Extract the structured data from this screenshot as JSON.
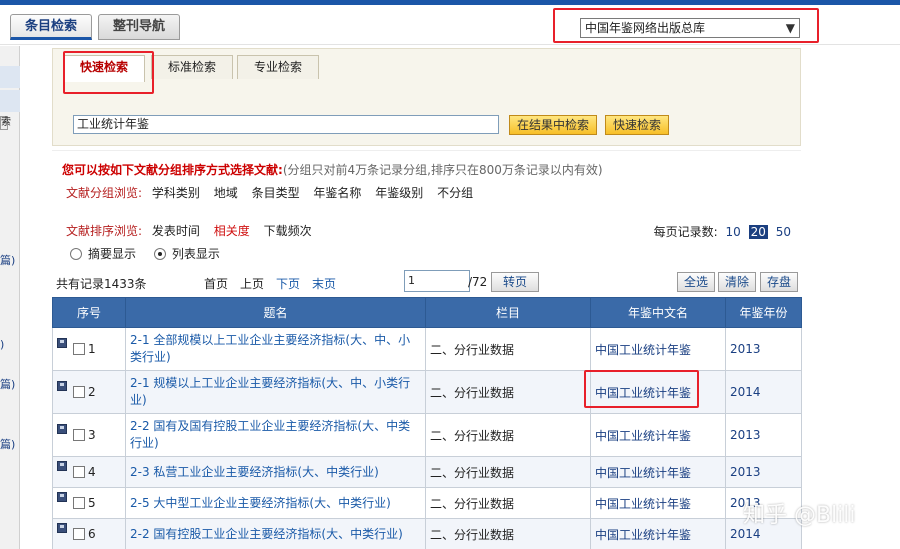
{
  "nav": {
    "tabs": [
      {
        "label": "条目检索",
        "active": true
      },
      {
        "label": "整刊导航",
        "active": false
      }
    ],
    "database_select": "中国年鉴网络出版总库"
  },
  "left_pane": {
    "fragments": [
      "索",
      "篇)",
      ")",
      "篇)",
      "篇)"
    ]
  },
  "search": {
    "tabs": [
      {
        "label": "快速检索",
        "active": true
      },
      {
        "label": "标准检索",
        "active": false
      },
      {
        "label": "专业检索",
        "active": false
      }
    ],
    "query": "工业统计年鉴",
    "btn_in_results": "在结果中检索",
    "btn_quick": "快速检索"
  },
  "grouping": {
    "heading": "您可以按如下文献分组排序方式选择文献:",
    "note": "(分组只对前4万条记录分组,排序只在800万条记录以内有效)",
    "browse_label": "文献分组浏览:",
    "browse_items": [
      "学科类别",
      "地域",
      "条目类型",
      "年鉴名称",
      "年鉴级别",
      "不分组"
    ],
    "sort_label": "文献排序浏览:",
    "sort_items": [
      {
        "label": "发表时间",
        "active": false
      },
      {
        "label": "相关度",
        "active": true
      },
      {
        "label": "下载频次",
        "active": false
      }
    ],
    "display_options": [
      {
        "label": "摘要显示",
        "selected": false
      },
      {
        "label": "列表显示",
        "selected": true
      }
    ],
    "per_page_label": "每页记录数:",
    "per_page_options": [
      "10",
      "20",
      "50"
    ],
    "per_page_current": "20"
  },
  "pager": {
    "total": "共有记录1433条",
    "links": [
      "首页",
      "上页",
      "下页",
      "末页"
    ],
    "page_value": "1",
    "page_total": "/72",
    "goto": "转页",
    "select_all": "全选",
    "clear": "清除",
    "save": "存盘"
  },
  "table": {
    "headers": [
      "序号",
      "题名",
      "栏目",
      "年鉴中文名",
      "年鉴年份"
    ],
    "rows": [
      {
        "no": "1",
        "title": "2-1 全部规模以上工业企业主要经济指标(大、中、小类行业)",
        "column": "二、分行业数据",
        "yearbook": "中国工业统计年鉴",
        "year": "2013"
      },
      {
        "no": "2",
        "title": "2-1 规模以上工业企业主要经济指标(大、中、小类行业)",
        "column": "二、分行业数据",
        "yearbook": "中国工业统计年鉴",
        "year": "2014"
      },
      {
        "no": "3",
        "title": "2-2 国有及国有控股工业企业主要经济指标(大、中类行业)",
        "column": "二、分行业数据",
        "yearbook": "中国工业统计年鉴",
        "year": "2013"
      },
      {
        "no": "4",
        "title": "2-3 私营工业企业主要经济指标(大、中类行业)",
        "column": "二、分行业数据",
        "yearbook": "中国工业统计年鉴",
        "year": "2013"
      },
      {
        "no": "5",
        "title": "2-5 大中型工业企业主要经济指标(大、中类行业)",
        "column": "二、分行业数据",
        "yearbook": "中国工业统计年鉴",
        "year": "2013"
      },
      {
        "no": "6",
        "title": "2-2 国有控股工业企业主要经济指标(大、中类行业)",
        "column": "二、分行业数据",
        "yearbook": "中国工业统计年鉴",
        "year": "2014"
      }
    ]
  },
  "watermark": "知乎 @Blili"
}
